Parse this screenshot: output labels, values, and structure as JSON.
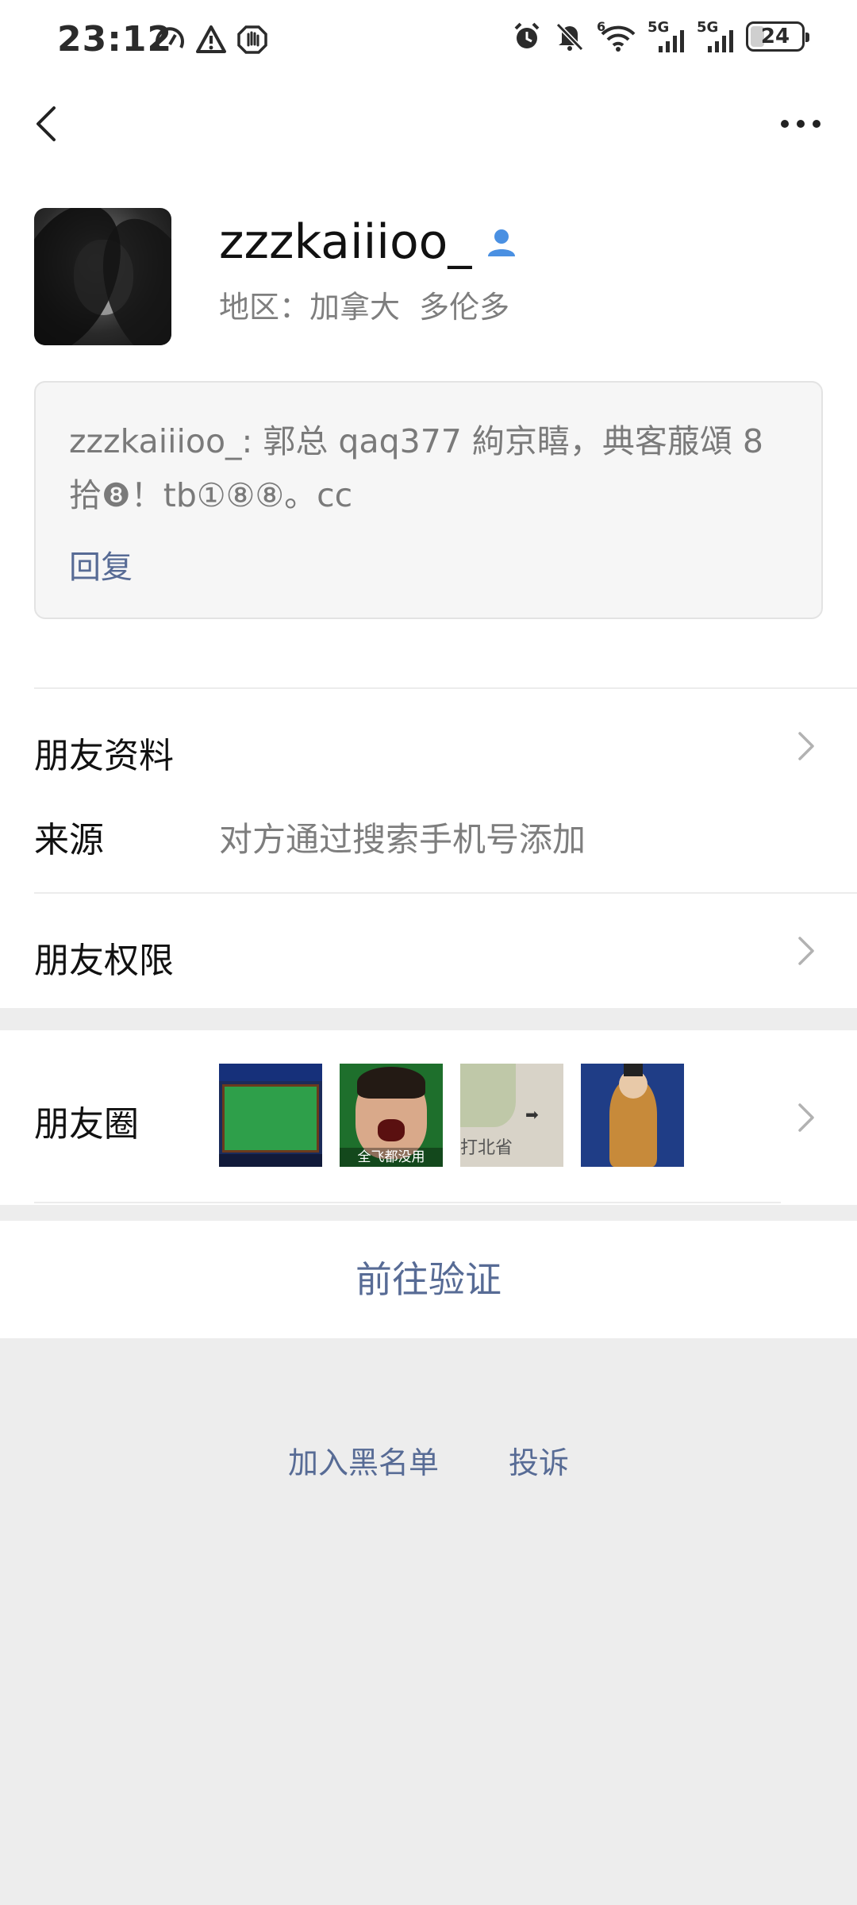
{
  "status_bar": {
    "time": "23:12",
    "icons_left": [
      "speedometer-icon",
      "warning-icon",
      "hand-icon"
    ],
    "icons_right": [
      "alarm-icon",
      "mute-icon",
      "wifi-icon",
      "signal-5g-icon",
      "signal-5g-icon"
    ],
    "wifi_label": "6",
    "sim1_label": "5G",
    "sim2_label": "5G",
    "battery": "24"
  },
  "nav": {
    "back_icon": "chevron-left-icon",
    "more_icon": "more-dots-icon"
  },
  "profile": {
    "nickname": "zzzkaiiioo_",
    "gender_icon": "person-icon",
    "region": "地区：加拿大  多伦多"
  },
  "verification_message": {
    "text": "zzzkaiiioo_: 郭总 qaq377 絇京瞦，典客菔頌 8 拾❽！tb①⑧⑧。cc",
    "reply_label": "回复"
  },
  "rows": {
    "friend_profile": "朋友资料",
    "source_label": "来源",
    "source_value": "对方通过搜索手机号添加",
    "friend_permissions": "朋友权限",
    "moments": "朋友圈",
    "moments_thumb2_caption": "全飞都没用",
    "moments_thumb3_caption": "打北省"
  },
  "actions": {
    "verify": "前往验证",
    "blacklist": "加入黑名单",
    "report": "投诉"
  },
  "colors": {
    "link": "#576b95",
    "accent_icon": "#4a90e2",
    "background": "#ededed"
  }
}
